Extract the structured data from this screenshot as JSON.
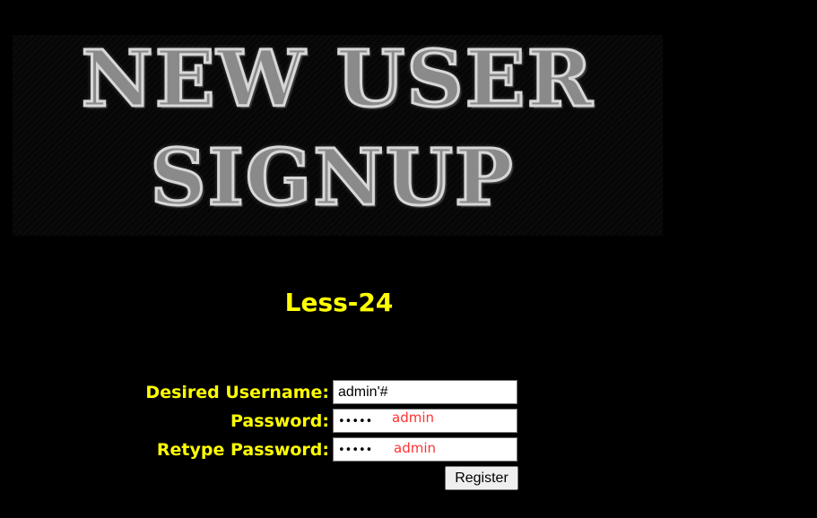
{
  "banner": {
    "line1": "NEW USER",
    "line2": "SIGNUP"
  },
  "lesson_title": "Less-24",
  "form": {
    "username": {
      "label": "Desired Username:",
      "value": "admin'#"
    },
    "password": {
      "label": "Password:",
      "value_masked": "•••••",
      "annotation": "admin"
    },
    "retype_password": {
      "label": "Retype Password:",
      "value_masked": "•••••",
      "annotation": "admin"
    },
    "submit_label": "Register"
  },
  "colors": {
    "background": "#000000",
    "label": "#ffff00",
    "annotation": "#ff3333"
  }
}
